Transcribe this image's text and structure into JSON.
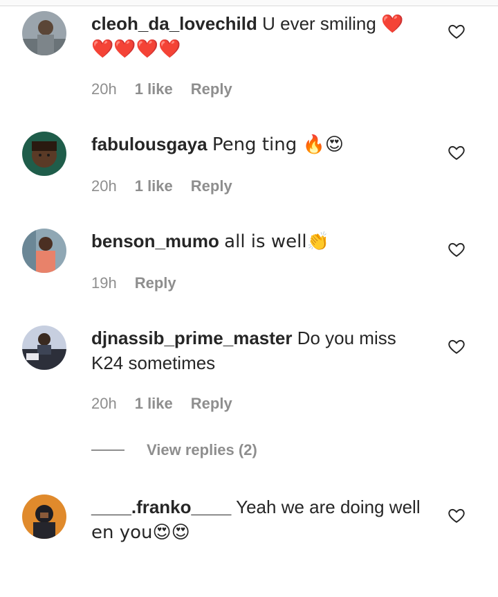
{
  "comments": [
    {
      "username": "cleoh_da_lovechild",
      "text": "U ever smiling ❤️",
      "text_line2": "❤️❤️❤️❤️",
      "time": "20h",
      "likes": "1 like",
      "reply": "Reply"
    },
    {
      "username": "fabulousgaya",
      "text": "Peng ting 🔥😍",
      "time": "20h",
      "likes": "1 like",
      "reply": "Reply"
    },
    {
      "username": "benson_mumo",
      "text": "all is well👏",
      "time": "19h",
      "reply": "Reply"
    },
    {
      "username": "djnassib_prime_master",
      "text": "Do you miss",
      "text_line2": "K24 sometimes",
      "time": "20h",
      "likes": "1 like",
      "reply": "Reply"
    },
    {
      "username": "____.franko____",
      "text": "Yeah we are doing well",
      "text_line2": "en you😍😍"
    }
  ],
  "view_replies": "View replies (2)",
  "colors": {
    "text": "#262626",
    "meta": "#8e8e8e",
    "heart_emoji": "#e0245e"
  }
}
